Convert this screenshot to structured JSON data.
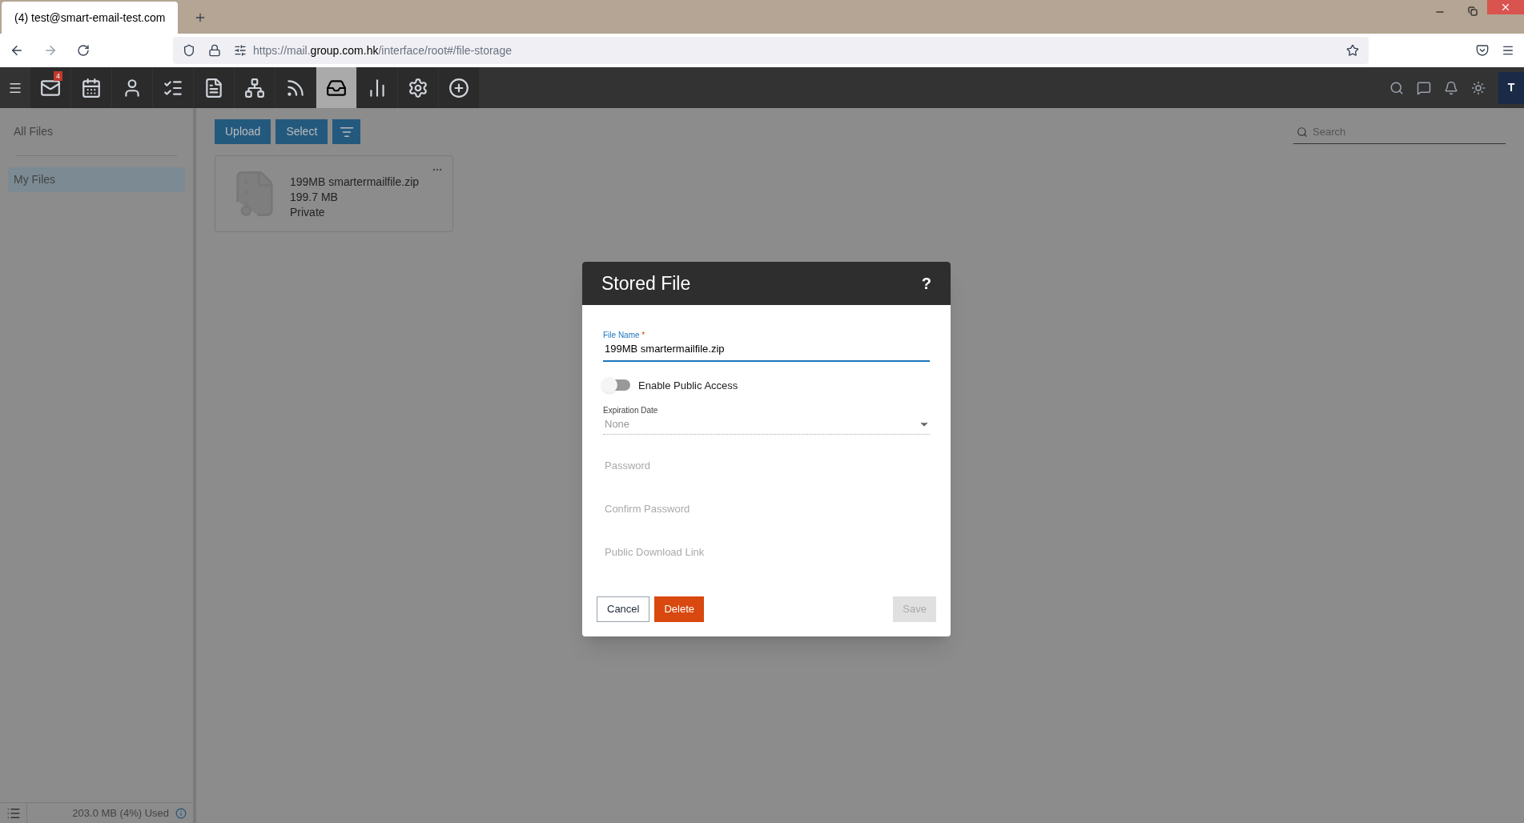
{
  "browser": {
    "tab": {
      "title": "(4) test@smart-email-test.com",
      "selected": true
    },
    "url_parts": [
      {
        "text": "https://mail.",
        "emphasis": false
      },
      {
        "text": "group.com.hk",
        "emphasis": true
      },
      {
        "text": "/interface/root#/file-storage",
        "emphasis": false
      }
    ]
  },
  "toolbar": {
    "items": [
      {
        "kind": "mail",
        "selected": false,
        "badge": "4"
      },
      {
        "kind": "calendar",
        "selected": false
      },
      {
        "kind": "contacts",
        "selected": false
      },
      {
        "kind": "tasks",
        "selected": false
      },
      {
        "kind": "notes",
        "selected": false
      },
      {
        "kind": "org",
        "selected": false
      },
      {
        "kind": "rss",
        "selected": false
      },
      {
        "kind": "files",
        "selected": true
      },
      {
        "kind": "reports",
        "selected": false
      },
      {
        "kind": "settings",
        "selected": false
      },
      {
        "kind": "add",
        "selected": false
      }
    ],
    "avatar": "T"
  },
  "sidebar": {
    "items": [
      {
        "label": "All Files",
        "selected": false
      },
      {
        "label": "My Files",
        "selected": true
      }
    ],
    "usage": "203.0 MB (4%) Used"
  },
  "actions": [
    "Upload",
    "Select"
  ],
  "search": {
    "placeholder": "Search"
  },
  "files": [
    {
      "name": "199MB smartermailfile.zip",
      "size": "199.7 MB",
      "visibility": "Private"
    }
  ],
  "dialog": {
    "title": "Stored File",
    "help": "?",
    "file_name": {
      "label": "File Name",
      "required": "*",
      "value": "199MB smartermailfile.zip"
    },
    "public_access": {
      "label": "Enable Public Access",
      "on": false
    },
    "expiration": {
      "label": "Expiration Date",
      "value": "None"
    },
    "fields": [
      {
        "placeholder": "Password"
      },
      {
        "placeholder": "Confirm Password"
      },
      {
        "placeholder": "Public Download Link"
      }
    ],
    "buttons": [
      {
        "label": "Cancel",
        "kind": "plain",
        "disabled": false
      },
      {
        "label": "Delete",
        "kind": "danger",
        "disabled": false
      },
      {
        "label": "Save",
        "kind": "primary",
        "disabled": true
      }
    ]
  }
}
